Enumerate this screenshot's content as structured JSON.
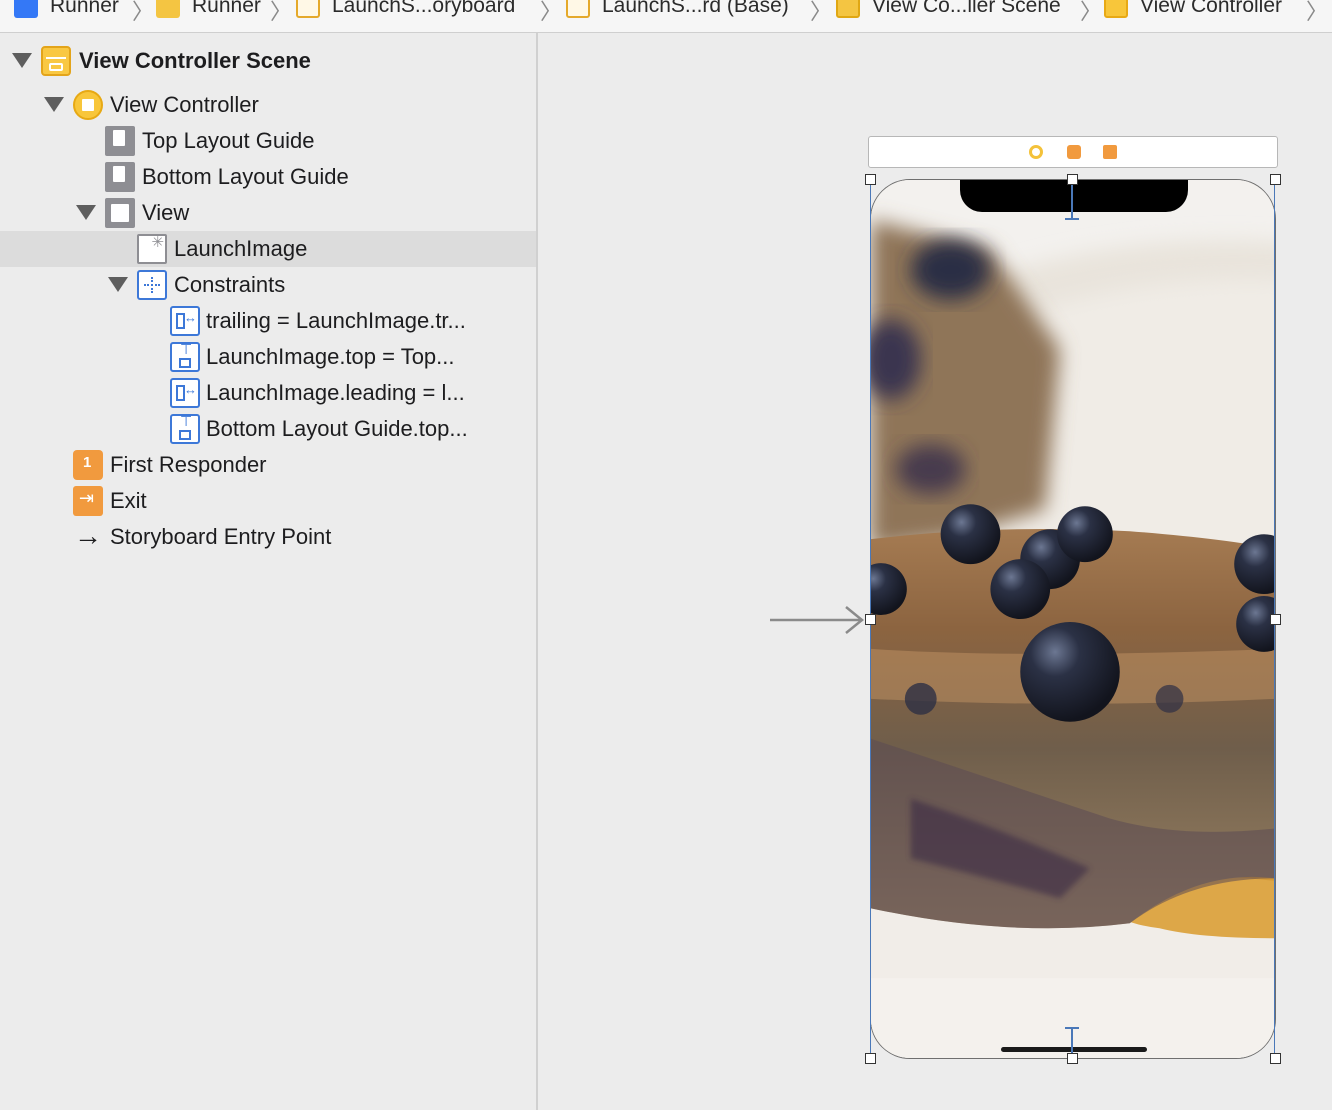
{
  "jumpbar": {
    "crumbs": [
      {
        "label": "Runner",
        "icon": "xcode-app-icon"
      },
      {
        "label": "Runner",
        "icon": "folder-icon"
      },
      {
        "label": "LaunchS...oryboard",
        "icon": "storyboard-file-icon"
      },
      {
        "label": "LaunchS...rd (Base)",
        "icon": "storyboard-file-icon"
      },
      {
        "label": "View Co...ller Scene",
        "icon": "scene-icon"
      },
      {
        "label": "View Controller",
        "icon": "view-controller-icon"
      }
    ],
    "separator": "〉"
  },
  "outline": {
    "scene": {
      "label": "View Controller Scene",
      "icon": "scene-icon"
    },
    "view_controller": {
      "label": "View Controller",
      "icon": "view-controller-icon"
    },
    "top_layout_guide": {
      "label": "Top Layout Guide",
      "icon": "layout-guide-icon"
    },
    "bottom_layout_guide": {
      "label": "Bottom Layout Guide",
      "icon": "layout-guide-icon"
    },
    "view": {
      "label": "View",
      "icon": "view-icon"
    },
    "launch_image": {
      "label": "LaunchImage",
      "icon": "image-view-icon",
      "selected": true
    },
    "constraints": {
      "label": "Constraints",
      "icon": "constraints-icon"
    },
    "constraint_items": [
      {
        "label": "trailing = LaunchImage.tr...",
        "icon": "horizontal-constraint-icon"
      },
      {
        "label": "LaunchImage.top = Top...",
        "icon": "vertical-constraint-icon"
      },
      {
        "label": "LaunchImage.leading = l...",
        "icon": "horizontal-constraint-icon"
      },
      {
        "label": "Bottom Layout Guide.top...",
        "icon": "vertical-constraint-icon"
      }
    ],
    "first_responder": {
      "label": "First Responder",
      "icon": "first-responder-icon"
    },
    "exit": {
      "label": "Exit",
      "icon": "exit-icon"
    },
    "entry_point": {
      "label": "Storyboard Entry Point",
      "icon": "arrow-right-icon"
    }
  },
  "canvas": {
    "scene_dock_icons": [
      "view-controller-icon",
      "first-responder-icon",
      "exit-icon"
    ],
    "device_image": "blueberry-baked-oatmeal-photo"
  },
  "colors": {
    "accent_blue": "#3d78d8",
    "selection": "#dcdcdc",
    "scene_yellow": "#f9c843",
    "responder_orange": "#f19a3e"
  }
}
